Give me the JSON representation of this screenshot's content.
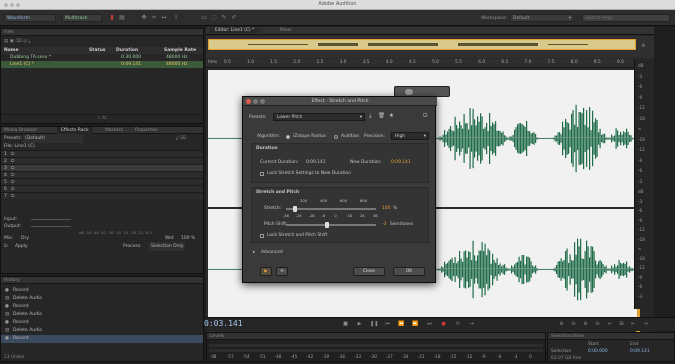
{
  "window": {
    "title": "Adobe Audition"
  },
  "toolbar": {
    "waveform": "Waveform",
    "multitrack": "Multitrack",
    "workspace_label": "Workspace:",
    "workspace_value": "Default",
    "search_placeholder": "Search Help"
  },
  "files": {
    "header": "Files",
    "col_name": "Name",
    "col_status": "Status",
    "col_duration": "Duration",
    "col_sample_rate": "Sample Rate",
    "rows": [
      {
        "name": "Dubbing TA.sesx *",
        "duration": "0:30.000",
        "rate": "48000 Hz"
      },
      {
        "name": "Line1 (C) *",
        "duration": "0:09.141",
        "rate": "48000 Hz"
      }
    ]
  },
  "rack": {
    "tabs": [
      "Media Browser",
      "Effects Rack",
      "Markers",
      "Properties"
    ],
    "presets_label": "Presets:",
    "presets_value": "(Default)",
    "file_label": "File: Line1 (C)",
    "slots": [
      "1",
      "2",
      "3",
      "4",
      "5",
      "6",
      "7",
      "8"
    ],
    "input_label": "Input:",
    "output_label": "Output:",
    "mix_label": "Mix:",
    "dry": "Dry",
    "wet": "Wet",
    "wet_value": "100 %",
    "apply": "Apply",
    "process_label": "Process:",
    "process_value": "Selection Only"
  },
  "history": {
    "header": "History",
    "items": [
      "Record",
      "Delete Audio",
      "Record",
      "Delete Audio",
      "Record",
      "Delete Audio",
      "Record"
    ],
    "undo_count": "13 Undos"
  },
  "editor": {
    "tab": "Editor: Line1 (C) *",
    "mixer": "Mixer",
    "ruler_unit": "hms",
    "ruler_ticks": [
      "0.5",
      "1.0",
      "1.5",
      "2.0",
      "2.5",
      "3.0",
      "3.5",
      "4.0",
      "4.5",
      "5.0",
      "5.5",
      "6.0",
      "6.5",
      "7.0",
      "7.5",
      "8.0",
      "8.5",
      "9.0"
    ],
    "db_scale_top": [
      "dB",
      "-3",
      "-6",
      "-9",
      "-12",
      "-18",
      "∞",
      "-18",
      "-12",
      "-9",
      "-6",
      "-3"
    ],
    "db_scale_bottom": [
      "dB",
      "-3",
      "-6",
      "-9",
      "-12",
      "-18",
      "∞",
      "-18",
      "-12",
      "-9",
      "-6",
      "-3"
    ],
    "timecode": "0:03.141"
  },
  "levels": {
    "header": "Levels",
    "scale": [
      "dB",
      "-57",
      "-54",
      "-51",
      "-48",
      "-45",
      "-42",
      "-39",
      "-36",
      "-33",
      "-30",
      "-27",
      "-24",
      "-21",
      "-18",
      "-15",
      "-12",
      "-9",
      "-6",
      "-3",
      "0"
    ]
  },
  "selection_view": {
    "header": "Selection/View",
    "start": "Start",
    "end": "End",
    "selection_label": "Selection",
    "selection_start": "0:00.000",
    "selection_end": "0:09.141",
    "status": "63.07 GB free"
  },
  "dialog": {
    "title": "Effect - Stretch and Pitch",
    "presets_label": "Presets:",
    "presets_value": "Lower Pitch",
    "algorithm_label": "Algorithm:",
    "algo_izotope": "iZotope Radius",
    "algo_audition": "Audition",
    "precision_label": "Precision:",
    "precision_value": "High",
    "duration_header": "Duration",
    "current_duration_label": "Current Duration:",
    "current_duration_value": "0:09.141",
    "new_duration_label": "New Duration:",
    "new_duration_value": "0:09.141",
    "lock_stretch": "Lock Stretch Settings to New Duration",
    "stretch_pitch_header": "Stretch and Pitch",
    "stretch_label": "Stretch:",
    "stretch_ticks": [
      "200",
      "400",
      "600",
      "800"
    ],
    "stretch_value": "100",
    "stretch_unit": "%",
    "pitch_label": "Pitch Shift:",
    "pitch_ticks": [
      "-36",
      "-24",
      "-18",
      "-6",
      "0",
      "18",
      "24",
      "36"
    ],
    "pitch_value": "-3",
    "pitch_unit": "Semitones",
    "lock_pitch": "Lock Stretch and Pitch Shift",
    "advanced": "Advanced",
    "close": "Close",
    "ok": "OK",
    "stretch_level": 0.1,
    "pitch_level": 0.46
  },
  "colors": {
    "accent": "#e8a33a",
    "wave": "#1f6b4a",
    "wave_bg": "#f1f1f1",
    "dialog_bg": "#3a3a3a"
  }
}
